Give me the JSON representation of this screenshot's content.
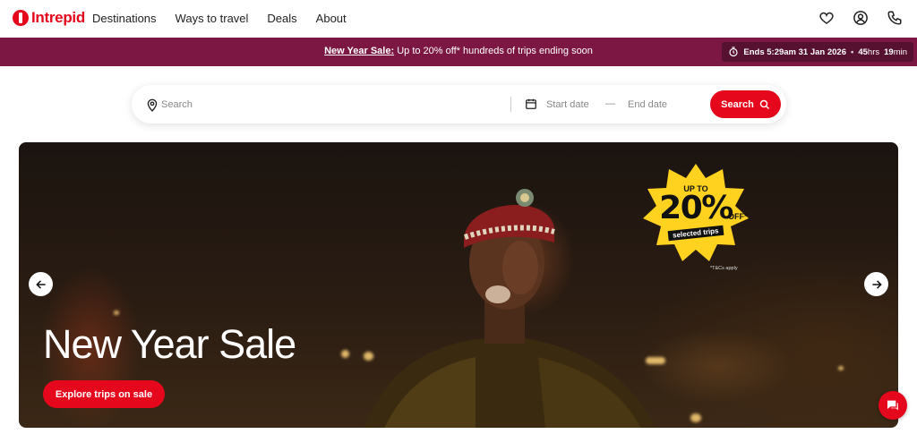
{
  "brand": {
    "name": "Intrepid",
    "accent": "#e5081c",
    "banner_bg": "#7c1743"
  },
  "nav": {
    "items": [
      {
        "label": "Destinations"
      },
      {
        "label": "Ways to travel"
      },
      {
        "label": "Deals"
      },
      {
        "label": "About"
      }
    ],
    "icons": [
      "heart-icon",
      "user-icon",
      "phone-icon"
    ]
  },
  "banner": {
    "sale_link": "New Year Sale:",
    "message": " Up to 20% off* hundreds of trips ending soon",
    "countdown": {
      "ends_label": "Ends 5:29am 31 Jan 2026",
      "separator": "•",
      "hours_value": "45",
      "hours_unit": "hrs",
      "minutes_value": "19",
      "minutes_unit": "min"
    }
  },
  "search": {
    "placeholder": "Search",
    "start_date": "Start date",
    "dash": "—",
    "end_date": "End date",
    "button_label": "Search"
  },
  "hero": {
    "title": "New Year Sale",
    "cta_label": "Explore trips on sale",
    "sticker": {
      "line1": "UP TO",
      "percent": "20%",
      "off": "OFF*",
      "tag": "selected trips"
    },
    "terms": "*T&Cs apply"
  }
}
